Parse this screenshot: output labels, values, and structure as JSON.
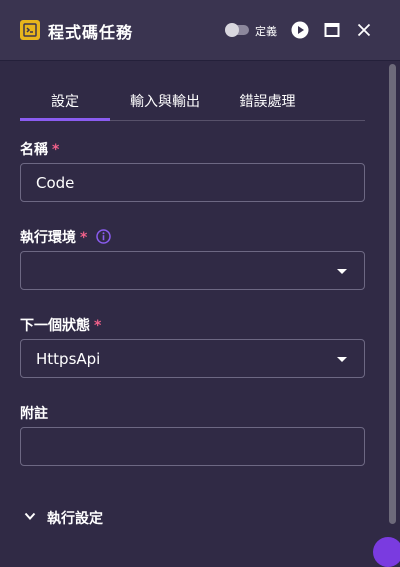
{
  "header": {
    "app_icon": "code-block-icon",
    "title": "程式碼任務",
    "toggle_label": "定義",
    "play_icon": "play-circle-icon",
    "maximize_icon": "maximize-icon",
    "close_icon": "close-icon"
  },
  "tabs": [
    {
      "label": "設定",
      "active": true
    },
    {
      "label": "輸入與輸出",
      "active": false
    },
    {
      "label": "錯誤處理",
      "active": false
    }
  ],
  "form": {
    "name": {
      "label": "名稱",
      "required_mark": "*",
      "value": "Code"
    },
    "runtime": {
      "label": "執行環境",
      "required_mark": "*",
      "value": "",
      "info_icon": "info-icon"
    },
    "next_state": {
      "label": "下一個狀態",
      "required_mark": "*",
      "value": "HttpsApi"
    },
    "note": {
      "label": "附註",
      "value": ""
    }
  },
  "section": {
    "label": "執行設定",
    "icon": "chevron-down-icon"
  },
  "colors": {
    "background": "#302a45",
    "header": "#3a3450",
    "accent": "#8a5cf0",
    "required": "#f0608a",
    "app_icon": "#e8b51c"
  }
}
